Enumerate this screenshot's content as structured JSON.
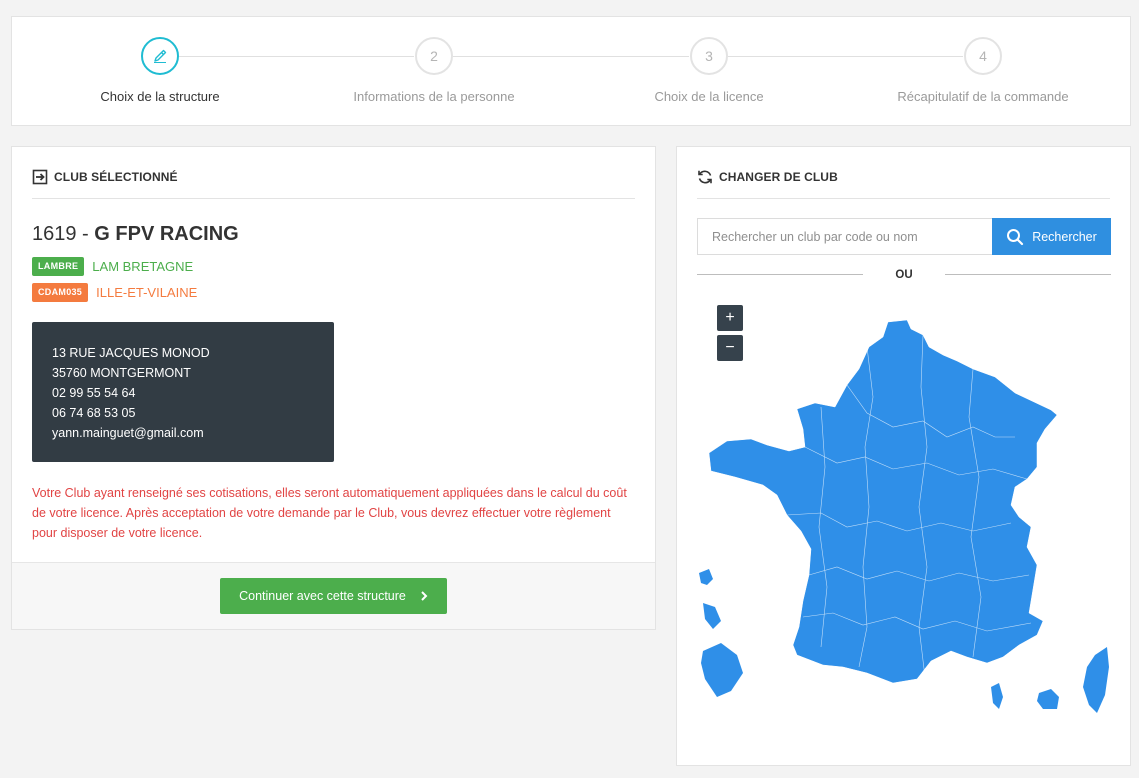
{
  "stepper": {
    "steps": [
      {
        "number": "",
        "label": "Choix de la structure",
        "active": true,
        "icon": "pencil-icon"
      },
      {
        "number": "2",
        "label": "Informations de la personne",
        "active": false
      },
      {
        "number": "3",
        "label": "Choix de la licence",
        "active": false
      },
      {
        "number": "4",
        "label": "Récapitulatif de la commande",
        "active": false
      }
    ]
  },
  "selected_club": {
    "heading": "CLUB SÉLECTIONNÉ",
    "heading_icon": "sign-in-icon",
    "code": "1619",
    "separator": " - ",
    "name": "G FPV RACING",
    "ligue_tag": "LAMBRE",
    "ligue_name": "LAM BRETAGNE",
    "ligue_color": "#4cae4c",
    "cd_tag": "CDAM035",
    "cd_name": "ILLE-ET-VILAINE",
    "cd_color": "#f47b3f",
    "address": {
      "street": "13 RUE JACQUES MONOD",
      "city": "35760 MONTGERMONT",
      "phone1": "02 99 55 54 64",
      "phone2": "06 74 68 53 05",
      "email": "yann.mainguet@gmail.com"
    },
    "notice": "Votre Club ayant renseigné ses cotisations, elles seront automatiquement appliquées dans le calcul du coût de votre licence. Après acceptation de votre demande par le Club, vous devrez effectuer votre règlement pour disposer de votre licence.",
    "continue_label": "Continuer avec cette structure",
    "continue_icon": "chevron-right-icon"
  },
  "change_club": {
    "heading": "CHANGER DE CLUB",
    "heading_icon": "refresh-icon",
    "search_placeholder": "Rechercher un club par code ou nom",
    "search_value": "",
    "search_button": "Rechercher",
    "search_icon": "search-icon",
    "or_label": "OU",
    "zoom_in": "+",
    "zoom_out": "−",
    "map_color": "#2f8fe8"
  }
}
